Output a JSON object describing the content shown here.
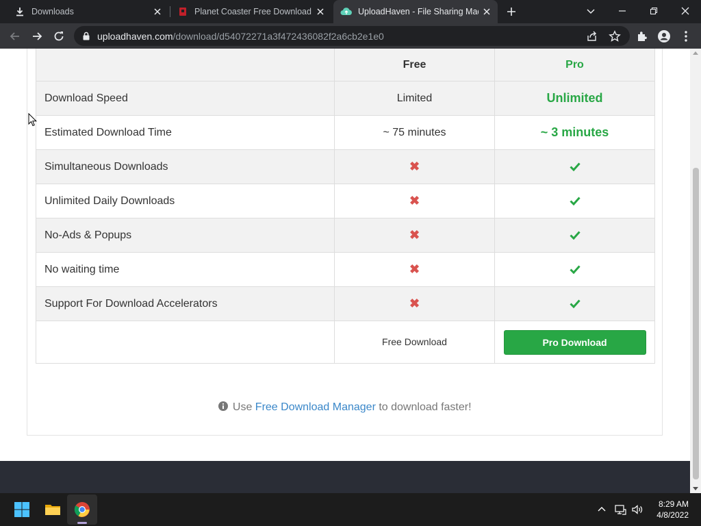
{
  "browser": {
    "tabs": [
      {
        "title": "Downloads",
        "icon": "download-icon",
        "active": false
      },
      {
        "title": "Planet Coaster Free Download (v",
        "icon": "game-favicon",
        "active": false
      },
      {
        "title": "UploadHaven - File Sharing Mad",
        "icon": "cloud-favicon",
        "active": true
      }
    ],
    "address": {
      "host": "uploadhaven.com",
      "path": "/download/d54072271a3f472436082f2a6cb2e1e0"
    }
  },
  "comparison": {
    "headers": {
      "feature": "",
      "free": "Free",
      "pro": "Pro"
    },
    "rows": [
      {
        "feature": "Download Speed",
        "free": "Limited",
        "pro": "Unlimited"
      },
      {
        "feature": "Estimated Download Time",
        "free": "~ 75 minutes",
        "pro": "~ 3 minutes"
      },
      {
        "feature": "Simultaneous Downloads",
        "free": "✖",
        "pro": "check"
      },
      {
        "feature": "Unlimited Daily Downloads",
        "free": "✖",
        "pro": "check"
      },
      {
        "feature": "No-Ads & Popups",
        "free": "✖",
        "pro": "check"
      },
      {
        "feature": "No waiting time",
        "free": "✖",
        "pro": "check"
      },
      {
        "feature": "Support For Download Accelerators",
        "free": "✖",
        "pro": "check"
      }
    ],
    "free_download_label": "Free Download",
    "pro_download_label": "Pro Download"
  },
  "tip": {
    "prefix": "Use",
    "link": "Free Download Manager",
    "suffix": "to download faster!"
  },
  "colors": {
    "pro_green": "#28a745",
    "cross_red": "#d9534f",
    "link_blue": "#3a87c9",
    "footer": "#2a2d36"
  },
  "taskbar": {
    "time": "8:29 AM",
    "date": "4/8/2022",
    "apps": [
      "windows-start-icon",
      "file-explorer-icon",
      "chrome-icon"
    ]
  }
}
